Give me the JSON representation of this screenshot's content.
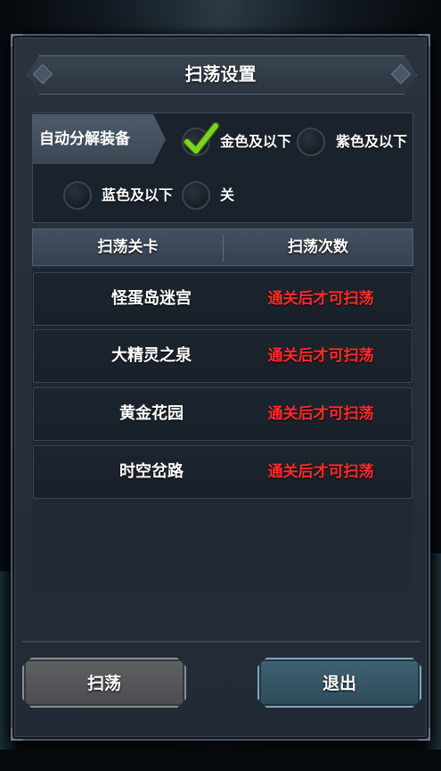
{
  "dialog": {
    "title": "扫荡设置"
  },
  "auto_decompose": {
    "label": "自动分解装备",
    "options": [
      {
        "label": "金色及以下",
        "selected": true
      },
      {
        "label": "紫色及以下",
        "selected": false
      },
      {
        "label": "蓝色及以下",
        "selected": false
      },
      {
        "label": "关",
        "selected": false
      }
    ]
  },
  "table": {
    "headers": [
      "扫荡关卡",
      "扫荡次数"
    ],
    "rows": [
      {
        "stage": "怪蛋岛迷宫",
        "status": "通关后才可扫荡"
      },
      {
        "stage": "大精灵之泉",
        "status": "通关后才可扫荡"
      },
      {
        "stage": "黄金花园",
        "status": "通关后才可扫荡"
      },
      {
        "stage": "时空岔路",
        "status": "通关后才可扫荡"
      }
    ]
  },
  "buttons": {
    "sweep": "扫荡",
    "exit": "退出"
  },
  "colors": {
    "status_red": "#ff2a2a",
    "check_green": "#7ed321"
  }
}
